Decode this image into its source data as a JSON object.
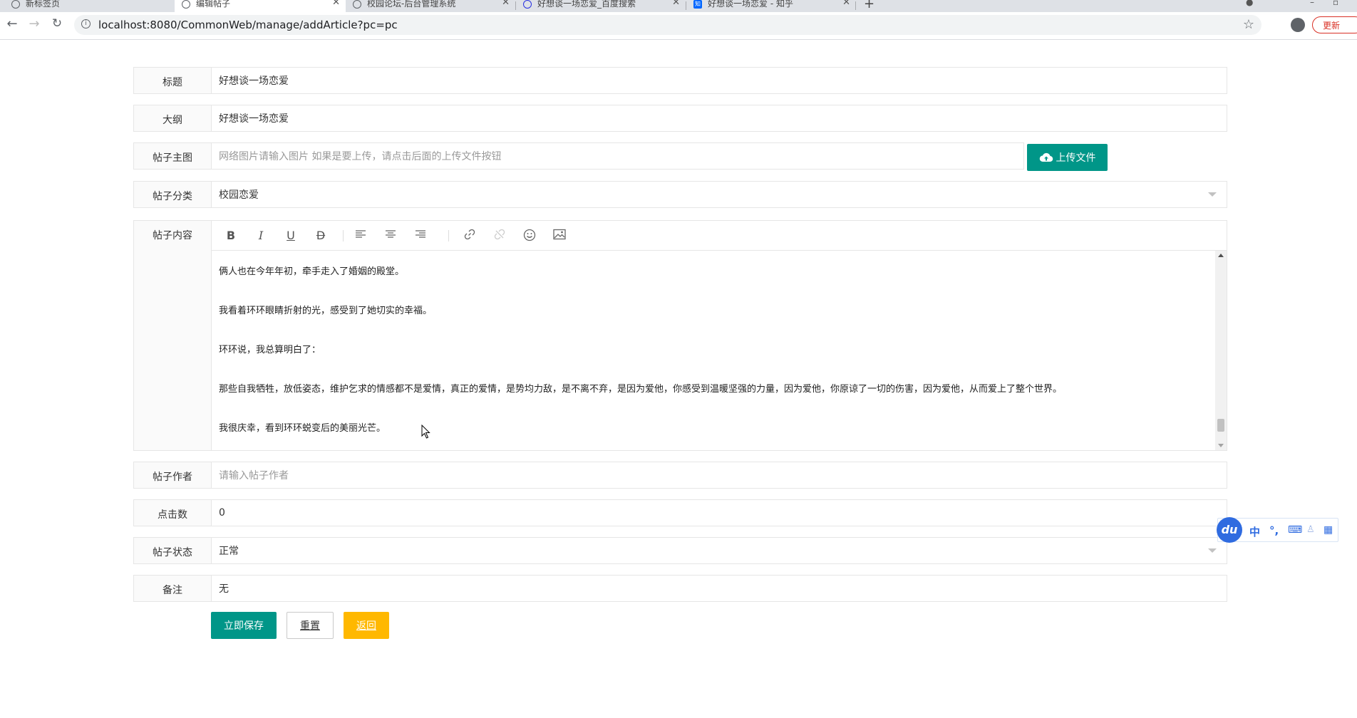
{
  "browser": {
    "tabs": [
      {
        "title": "新标签页",
        "icon": "chrome-icon"
      },
      {
        "title": "编辑帖子",
        "icon": "globe-icon",
        "active": true
      },
      {
        "title": "校园论坛-后台管理系统",
        "icon": "globe-icon"
      },
      {
        "title": "好想谈一场恋爱_百度搜索",
        "icon": "baidu-icon"
      },
      {
        "title": "好想谈一场恋爱 - 知乎",
        "icon": "zhihu-icon"
      }
    ],
    "new_tab_label": "+",
    "url": "localhost:8080/CommonWeb/manage/addArticle?pc=pc",
    "update_label": "更新"
  },
  "form": {
    "title": {
      "label": "标题",
      "value": "好想谈一场恋爱"
    },
    "outline": {
      "label": "大纲",
      "value": "好想谈一场恋爱"
    },
    "image": {
      "label": "帖子主图",
      "placeholder": "网络图片请输入图片 如果是要上传，请点击后面的上传文件按钮",
      "upload_label": "上传文件"
    },
    "category": {
      "label": "帖子分类",
      "value": "校园恋爱"
    },
    "content": {
      "label": "帖子内容",
      "paragraphs": [
        "俩人也在今年年初，牵手走入了婚姻的殿堂。",
        "我看着环环眼睛折射的光，感受到了她切实的幸福。",
        "环环说，我总算明白了：",
        "那些自我牺牲，放低姿态，维护乞求的情感都不是爱情，真正的爱情，是势均力敌，是不离不弃，是因为爱他，你感受到温暖坚强的力量，因为爱他，你原谅了一切的伤害，因为爱他，从而爱上了整个世界。",
        "我很庆幸，看到环环蜕变后的美丽光芒。"
      ],
      "scroll_position": 0.95
    },
    "author": {
      "label": "帖子作者",
      "placeholder": "请输入帖子作者"
    },
    "clicks": {
      "label": "点击数",
      "value": "0"
    },
    "status": {
      "label": "帖子状态",
      "value": "正常"
    },
    "remark": {
      "label": "备注",
      "value": "无"
    }
  },
  "actions": {
    "save_label": "立即保存",
    "reset_label": "重置",
    "back_label": "返回"
  },
  "ime": {
    "logo": "du",
    "mode": "中",
    "punct": "°,"
  },
  "colors": {
    "primary": "#009688",
    "warm": "#ffb800",
    "border": "#e6e6e6",
    "label_bg": "#fafafa"
  }
}
